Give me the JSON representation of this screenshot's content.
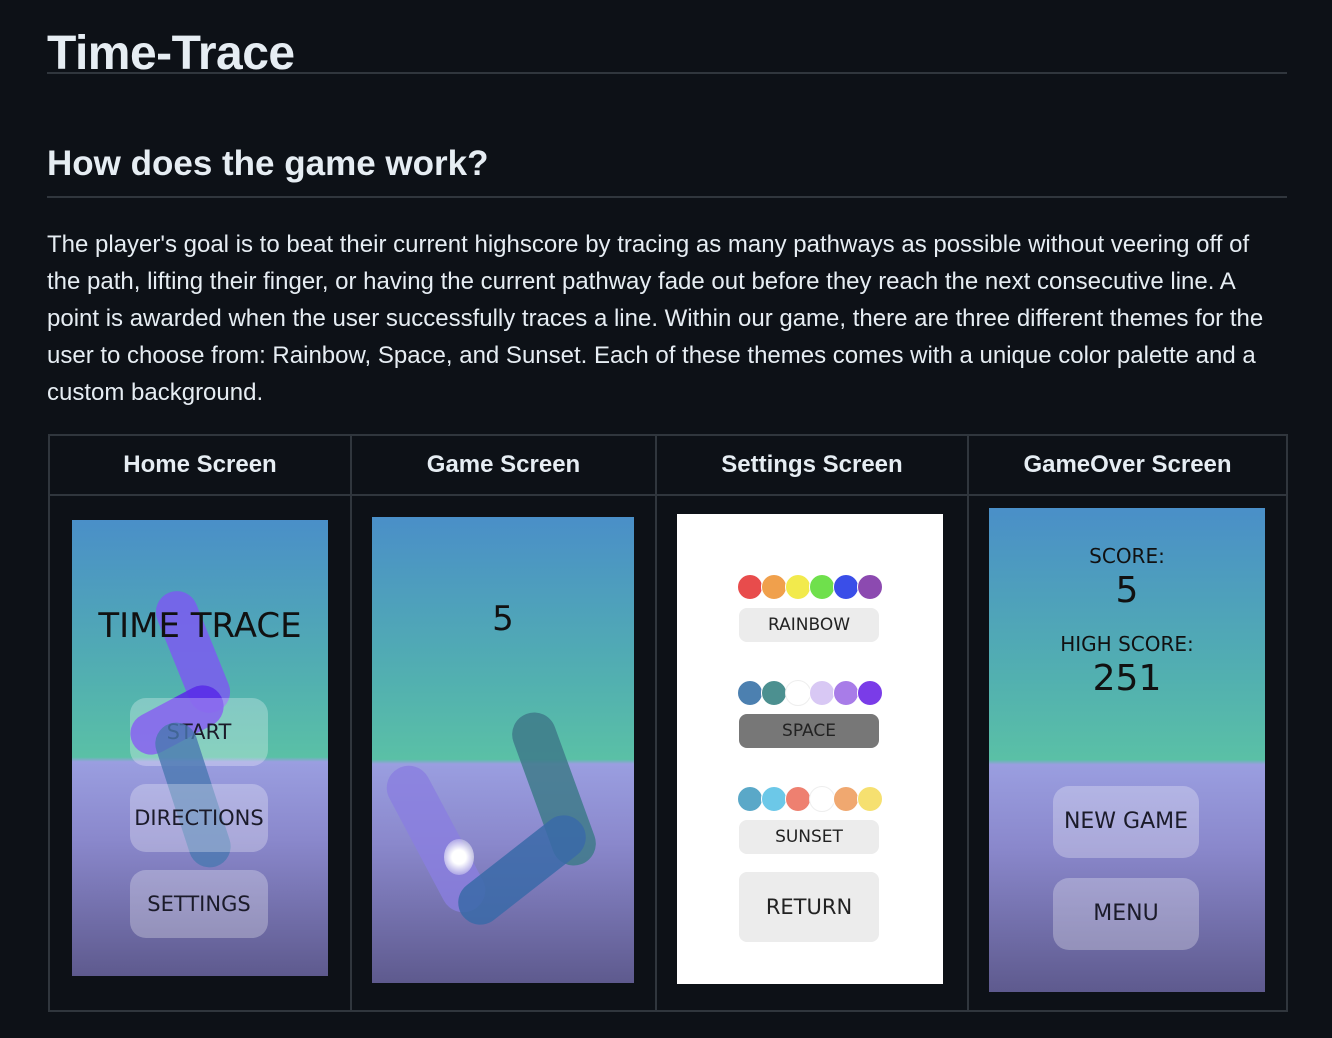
{
  "page": {
    "title": "Time-Trace",
    "section_heading": "How does the game work?",
    "description": "The player's goal is to beat their current highscore by tracing as many pathways as possible without veering off of the path, lifting their finger, or having the current pathway fade out before they reach the next consecutive line. A point is awarded when the user successfully traces a line. Within our game, there are three different themes for the user to choose from: Rainbow, Space, and Sunset. Each of these themes comes with a unique color palette and a custom background."
  },
  "table": {
    "headers": [
      "Home Screen",
      "Game Screen",
      "Settings Screen",
      "GameOver Screen"
    ]
  },
  "home": {
    "title": "TIME TRACE",
    "buttons": [
      "START",
      "DIRECTIONS",
      "SETTINGS"
    ]
  },
  "game": {
    "score": "5"
  },
  "settings": {
    "themes": [
      {
        "label": "RAINBOW",
        "colors": [
          "#e84c4c",
          "#f0a04c",
          "#f2ea4c",
          "#6fe04c",
          "#3a4ee8",
          "#8c4ab0"
        ]
      },
      {
        "label": "SPACE",
        "colors": [
          "#4c80b0",
          "#4c9090",
          "#ffffff",
          "#d8c8f4",
          "#a87ce8",
          "#7a3ce8"
        ]
      },
      {
        "label": "SUNSET",
        "colors": [
          "#5aa8c8",
          "#6cc8e8",
          "#ee8070",
          "#ffffff",
          "#f0a870",
          "#f6e070"
        ]
      }
    ],
    "return_label": "RETURN"
  },
  "gameover": {
    "score_label": "SCORE:",
    "score_value": "5",
    "high_label": "HIGH SCORE:",
    "high_value": "251",
    "new_game": "NEW GAME",
    "menu": "MENU"
  },
  "colors": {
    "background": "#0d1117",
    "text": "#e6edf3",
    "border": "#30363d"
  }
}
